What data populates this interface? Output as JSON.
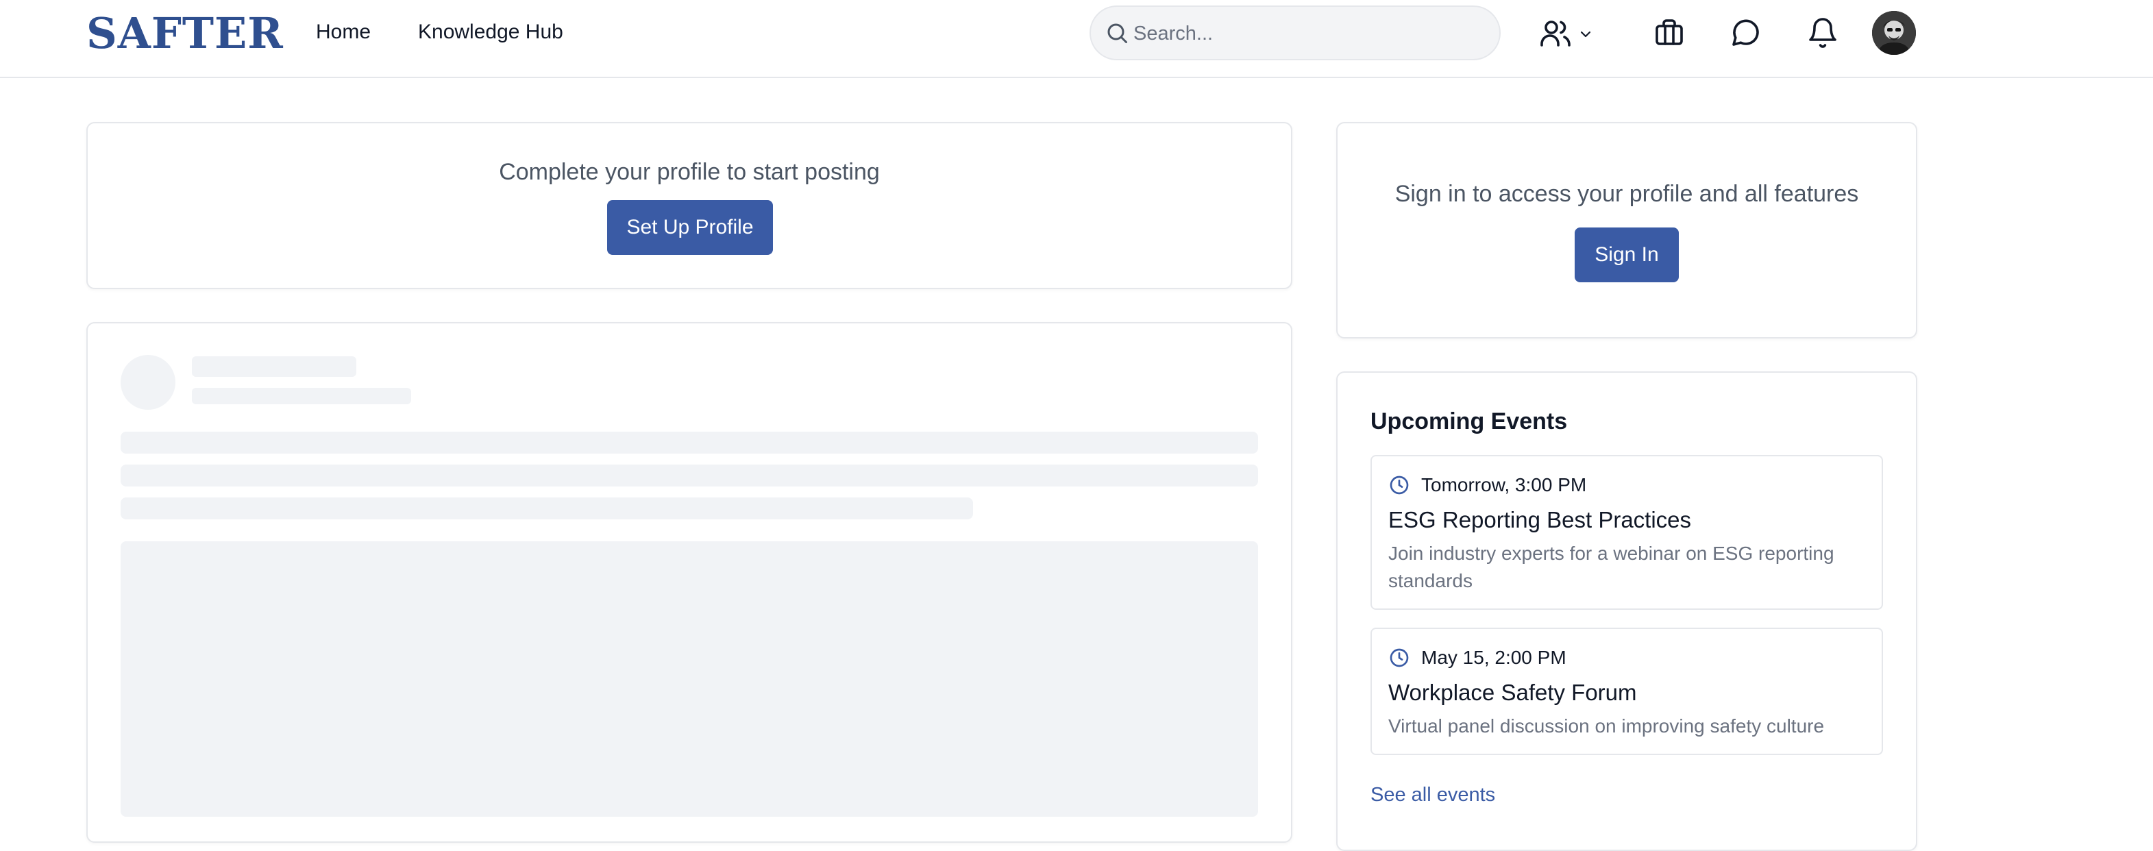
{
  "header": {
    "logo": "SAFTER",
    "nav": {
      "home": "Home",
      "knowledge_hub": "Knowledge Hub"
    },
    "search": {
      "placeholder": "Search..."
    },
    "icons": [
      "people-icon",
      "chevron-down-icon",
      "briefcase-icon",
      "chat-icon",
      "bell-icon"
    ]
  },
  "profile_card": {
    "title": "Complete your profile to start posting",
    "button": "Set Up Profile"
  },
  "signin_card": {
    "title": "Sign in to access your profile and all features",
    "button": "Sign In"
  },
  "events": {
    "heading": "Upcoming Events",
    "items": [
      {
        "time": "Tomorrow, 3:00 PM",
        "title": "ESG Reporting Best Practices",
        "description": "Join industry experts for a webinar on ESG reporting standards"
      },
      {
        "time": "May 15, 2:00 PM",
        "title": "Workplace Safety Forum",
        "description": "Virtual panel discussion on improving safety culture"
      }
    ],
    "see_all": "See all events"
  },
  "colors": {
    "brand": "#2f4f8f",
    "primary_button": "#3a5ba5",
    "skeleton": "#f1f3f6",
    "border": "#e5e7eb",
    "muted_text": "#6b7280"
  }
}
